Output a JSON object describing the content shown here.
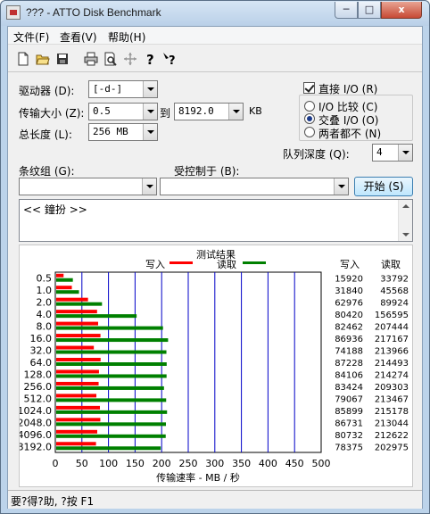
{
  "window": {
    "title": "??? - ATTO Disk Benchmark",
    "min_label": "─",
    "max_label": "□",
    "close_label": "x"
  },
  "menu": {
    "file": "文件(F)",
    "view": "查看(V)",
    "help": "帮助(H)"
  },
  "toolbar": {
    "icons": [
      "new-file-icon",
      "open-folder-icon",
      "save-icon",
      "print-icon",
      "print-preview-icon",
      "move-icon",
      "help-icon",
      "context-help-icon"
    ]
  },
  "form": {
    "drive_label": "驱动器 (D):",
    "drive_value": "[-d-]",
    "transfer_label": "传输大小 (Z):",
    "transfer_from": "0.5",
    "to_label": "到",
    "transfer_to": "8192.0",
    "kb_label": "KB",
    "length_label": "总长度 (L):",
    "length_value": "256 MB",
    "direct_io_label": "直接 I/O (R)",
    "io_compare_label": "I/O 比较 (C)",
    "overlap_io_label": "交叠 I/O (O)",
    "neither_label": "两者都不 (N)",
    "queue_label": "队列深度 (Q):",
    "queue_value": "4",
    "stripe_label": "条纹组 (G):",
    "stripe_value": "",
    "controlled_label": "受控制于 (B):",
    "controlled_value": "",
    "start_label": "开始 (S)",
    "memo_text": "<< 鐘扮 >>"
  },
  "results": {
    "title": "测试结果",
    "write_legend": "写入",
    "read_legend": "读取",
    "write_header": "写入",
    "read_header": "读取",
    "xlabel": "传输速率 - MB / 秒"
  },
  "status": {
    "text": "要?得?助, ?按 F1"
  },
  "chart_data": {
    "type": "bar",
    "orientation": "horizontal",
    "title": "测试结果",
    "xlabel": "传输速率 - MB / 秒",
    "categories": [
      "0.5",
      "1.0",
      "2.0",
      "4.0",
      "8.0",
      "16.0",
      "32.0",
      "64.0",
      "128.0",
      "256.0",
      "512.0",
      "1024.0",
      "2048.0",
      "4096.0",
      "8192.0"
    ],
    "series": [
      {
        "name": "写入",
        "color": "#ff0000",
        "values": [
          15920,
          31840,
          62976,
          80420,
          82462,
          86936,
          74188,
          87228,
          84106,
          83424,
          79067,
          85899,
          86731,
          80732,
          78375
        ]
      },
      {
        "name": "读取",
        "color": "#008000",
        "values": [
          33792,
          45568,
          89924,
          156595,
          207444,
          217167,
          213966,
          214493,
          214274,
          209303,
          213467,
          215178,
          213044,
          212622,
          202975
        ]
      }
    ],
    "xticks": [
      "0",
      "50",
      "100",
      "150",
      "200",
      "250",
      "300",
      "350",
      "400",
      "450",
      "500"
    ],
    "xlim": [
      0,
      500
    ],
    "value_unit": "KB/s",
    "grid": true,
    "legend": "top"
  }
}
